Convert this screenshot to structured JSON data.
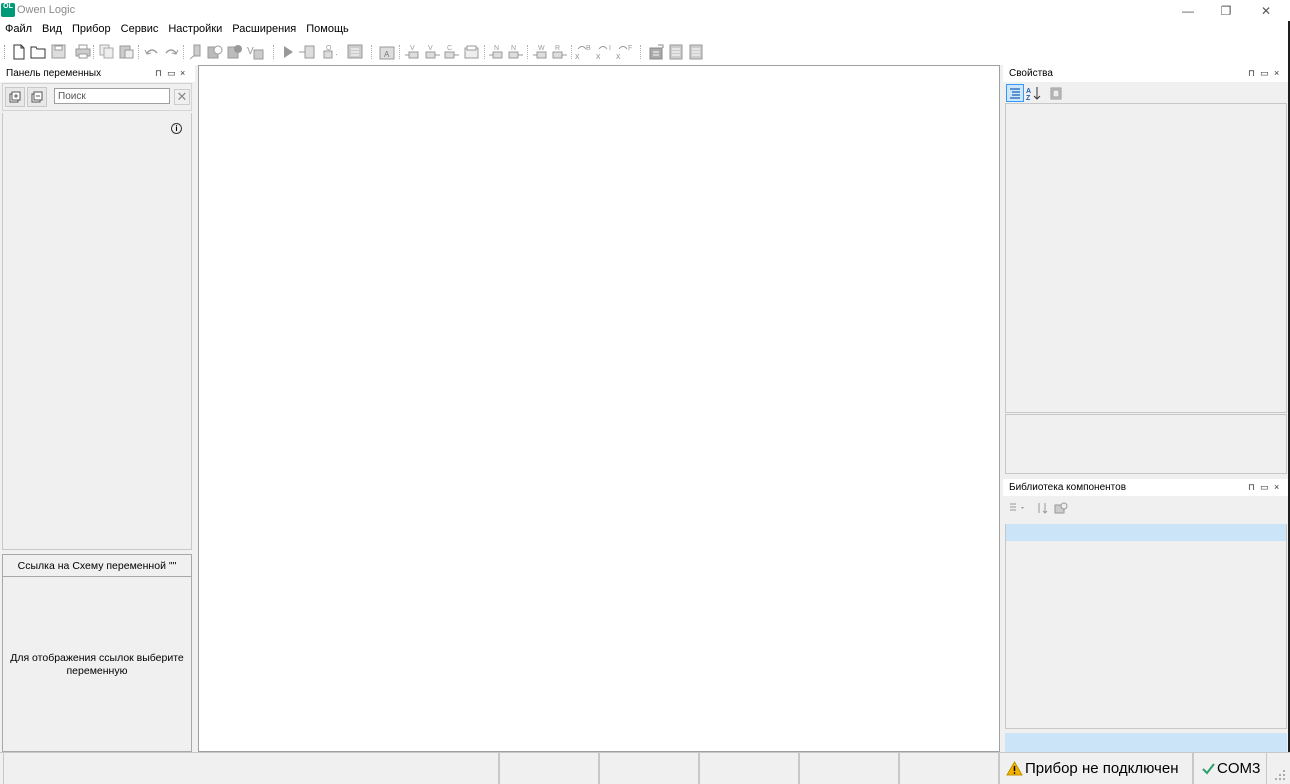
{
  "window": {
    "title": "Owen Logic",
    "logo_text": "OL",
    "controls": {
      "minimize": "—",
      "restore": "❐",
      "close": "✕"
    }
  },
  "menu": {
    "items": [
      "Файл",
      "Вид",
      "Прибор",
      "Сервис",
      "Настройки",
      "Расширения",
      "Помощь"
    ]
  },
  "toolbar": {
    "icons": [
      "new-file-icon",
      "open-folder-icon",
      "save-icon",
      "print-icon",
      "copy-icon",
      "paste-icon",
      "undo-icon",
      "redo-icon",
      "probe-icon",
      "find-icon",
      "settings-gear-icon",
      "value-icon",
      "run-icon",
      "block-insert-icon",
      "block-output-icon",
      "table-icon",
      "text-icon",
      "var-in-icon",
      "var-out-icon",
      "const-icon",
      "macro-icon",
      "net-in-icon",
      "net-out-icon",
      "write-icon",
      "read-icon",
      "var-b-icon",
      "var-i-icon",
      "var-f-icon",
      "component-icon",
      "list-icon",
      "page-icon"
    ]
  },
  "variables_panel": {
    "title": "Панель переменных",
    "pin": "⊓",
    "float": "▭",
    "close": "×",
    "search": {
      "placeholder": "Поиск",
      "clear": "✕"
    },
    "info": "i"
  },
  "reference_panel": {
    "title": "Ссылка на Схему переменной \"\"",
    "message": "Для отображения ссылок выберите переменную"
  },
  "properties_panel": {
    "title": "Свойства",
    "pin": "⊓",
    "float": "▭",
    "close": "×"
  },
  "library_panel": {
    "title": "Библиотека компонентов",
    "pin": "⊓",
    "float": "▭",
    "close": "×"
  },
  "statusbar": {
    "device_status": "Прибор не подключен",
    "port": "COM3",
    "warning_color": "#f2b300",
    "ok_color": "#2e9e6a"
  }
}
